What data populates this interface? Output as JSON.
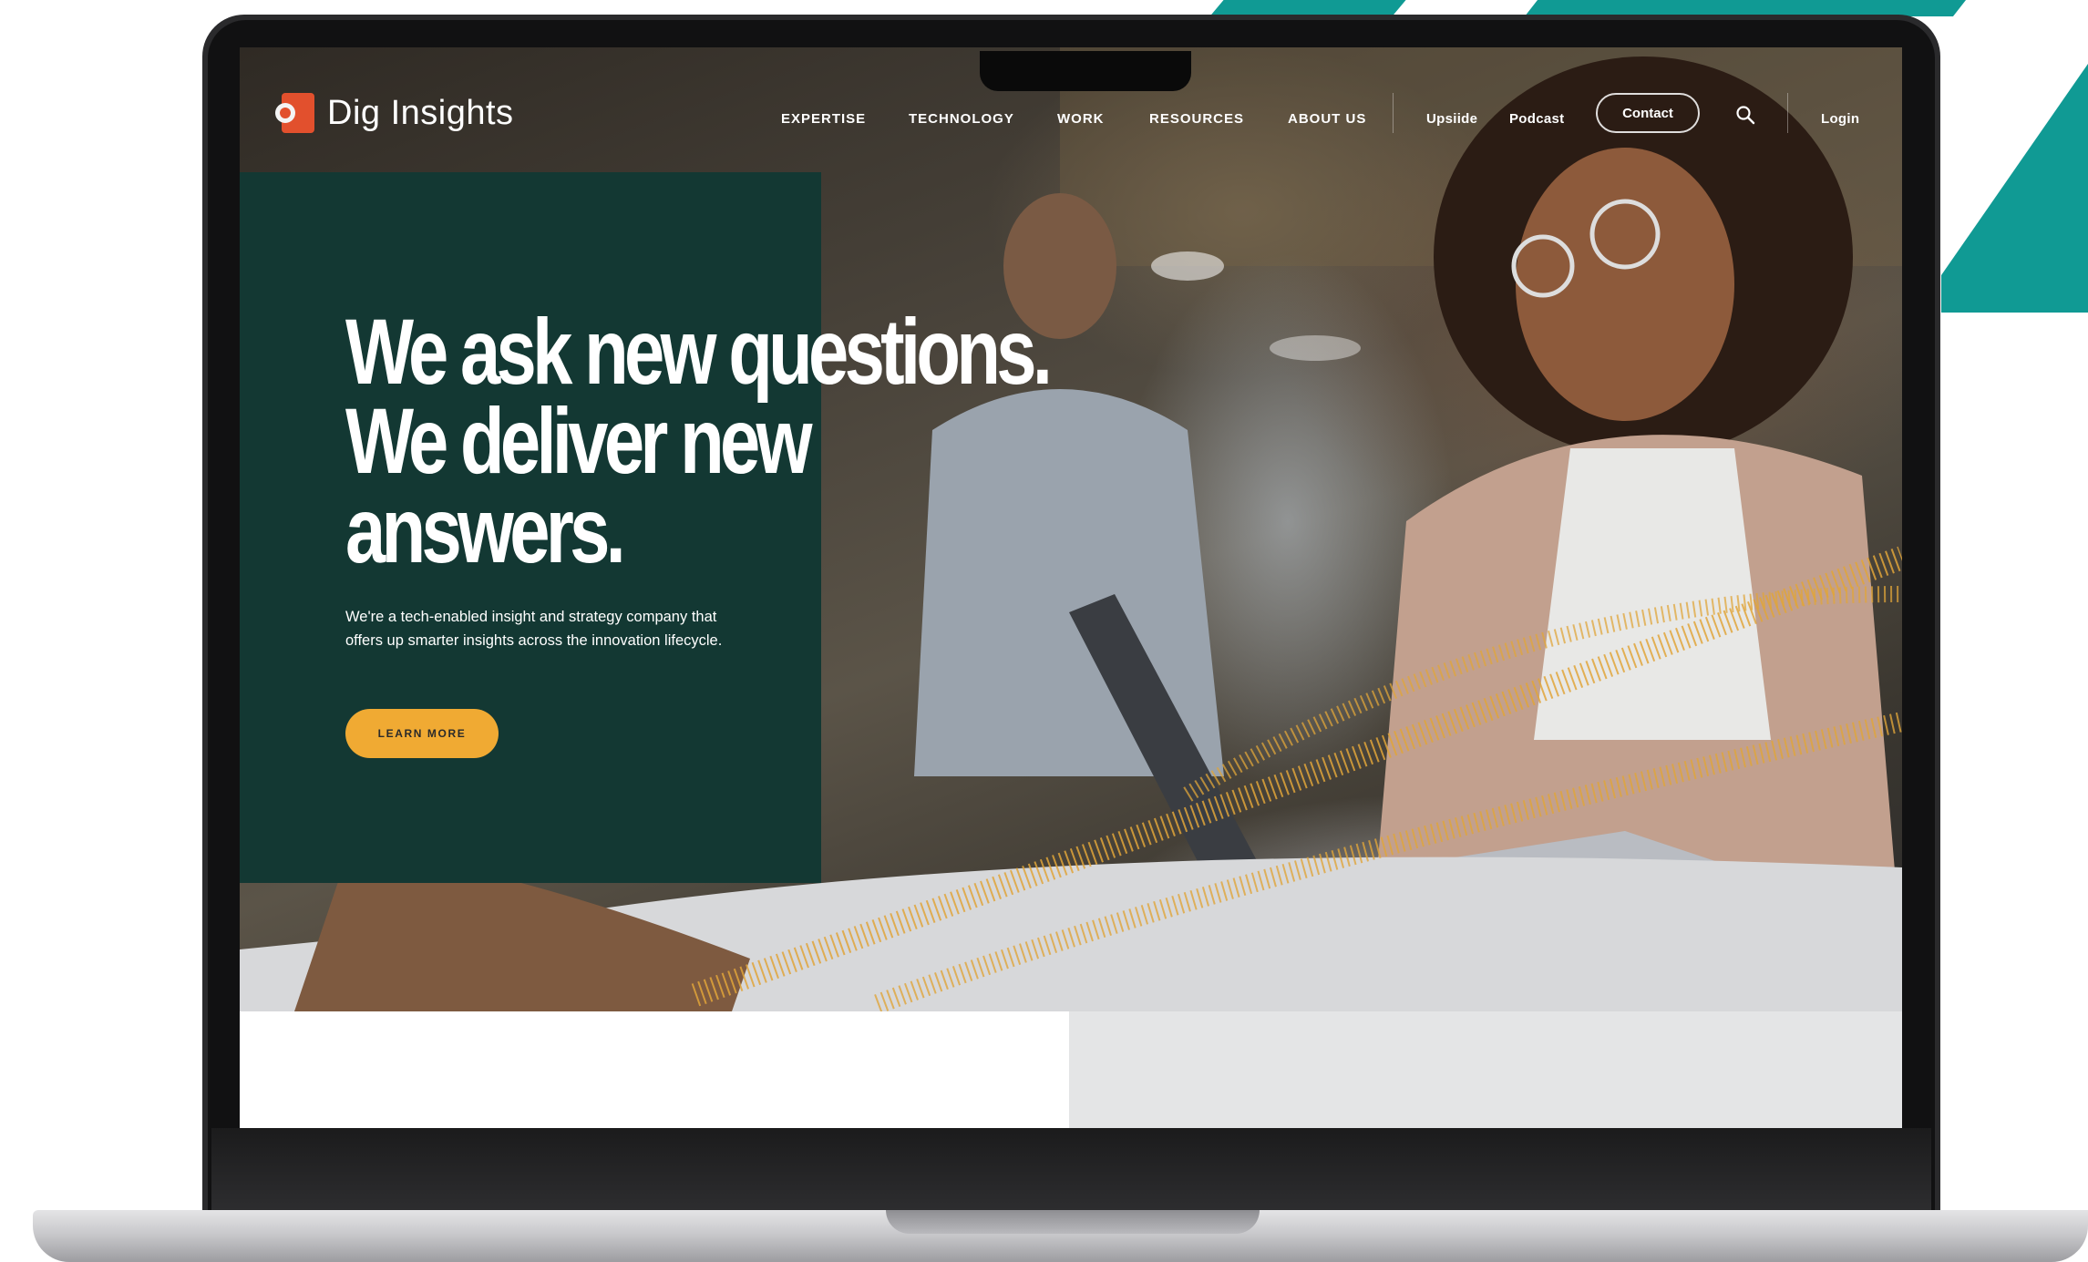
{
  "brand": {
    "name": "Dig Insights",
    "accent": "#e2502d",
    "panel_color": "#133833",
    "button_color": "#f0aa33",
    "frame_accent": "#109a94"
  },
  "nav": {
    "items": [
      {
        "label": "EXPERTISE"
      },
      {
        "label": "TECHNOLOGY"
      },
      {
        "label": "WORK"
      },
      {
        "label": "RESOURCES"
      },
      {
        "label": "ABOUT US"
      }
    ],
    "secondary": [
      {
        "label": "Upsiide"
      },
      {
        "label": "Podcast"
      }
    ],
    "contact_label": "Contact",
    "search_icon": "search-icon",
    "login_label": "Login"
  },
  "hero": {
    "headline_lines": [
      "We ask new questions.",
      "We deliver new",
      "answers."
    ],
    "body": "We're a tech-enabled insight and strategy company that offers up smarter insights across the innovation lifecycle.",
    "cta_label": "LEARN MORE"
  }
}
